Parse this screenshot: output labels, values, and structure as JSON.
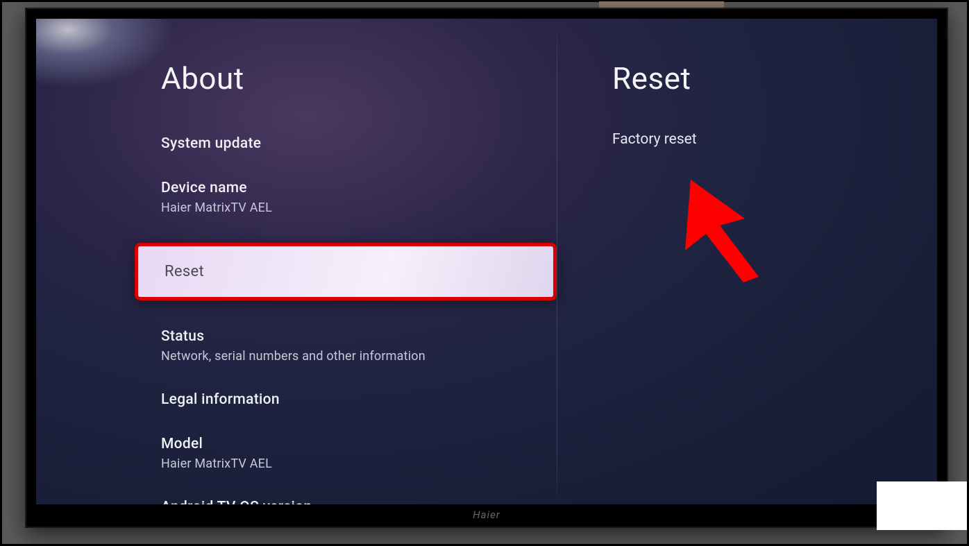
{
  "left": {
    "title": "About",
    "items": [
      {
        "title": "System update",
        "subtitle": null
      },
      {
        "title": "Device name",
        "subtitle": "Haier MatrixTV AEL"
      },
      {
        "title": "Reset",
        "subtitle": null,
        "selected": true
      },
      {
        "title": "Status",
        "subtitle": "Network, serial numbers and other information"
      },
      {
        "title": "Legal information",
        "subtitle": null
      },
      {
        "title": "Model",
        "subtitle": "Haier MatrixTV AEL"
      },
      {
        "title": "Android TV OS version",
        "subtitle": null
      }
    ]
  },
  "right": {
    "title": "Reset",
    "items": [
      {
        "title": "Factory reset"
      }
    ]
  },
  "tv_brand": "Haier"
}
